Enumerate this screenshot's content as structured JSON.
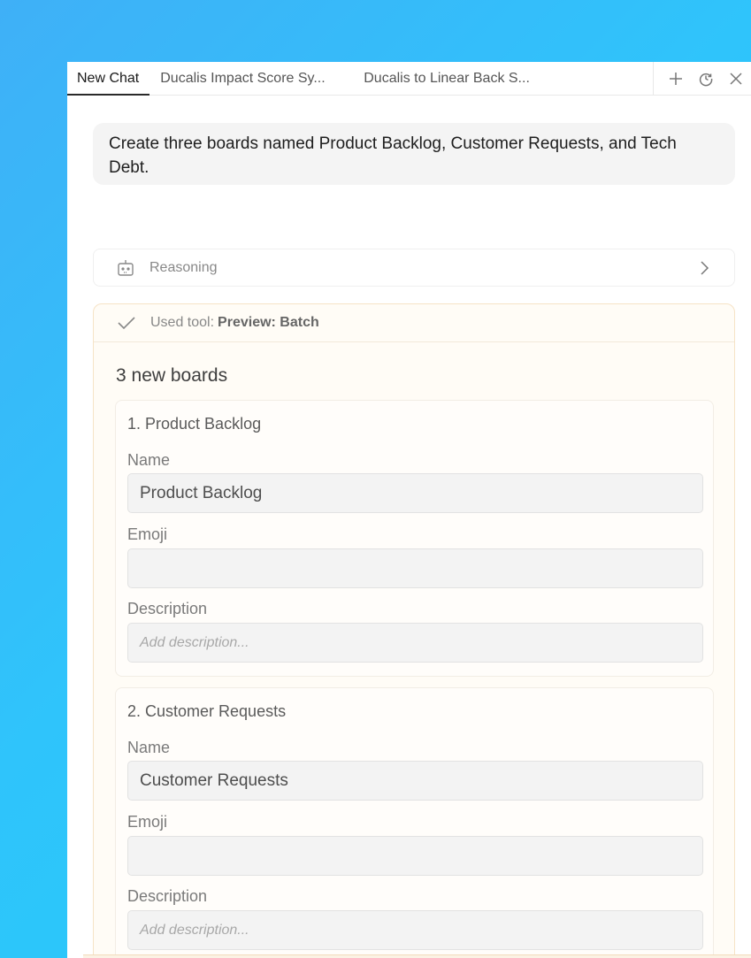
{
  "tabs": [
    {
      "label": "New Chat"
    },
    {
      "label": "Ducalis Impact Score Sy..."
    },
    {
      "label": "Ducalis to Linear Back S..."
    }
  ],
  "tab_actions": {
    "new": "plus-icon",
    "history": "history-icon",
    "close": "close-icon"
  },
  "user_message": "Create three boards named Product Backlog, Customer Requests, and Tech Debt.",
  "reasoning": {
    "label": "Reasoning"
  },
  "tool": {
    "prefix": "Used tool:",
    "name": "Preview: Batch",
    "title": "3 new boards",
    "boards": [
      {
        "heading": "1. Product Backlog",
        "name_label": "Name",
        "name_value": "Product Backlog",
        "emoji_label": "Emoji",
        "emoji_value": "",
        "description_label": "Description",
        "description_placeholder": "Add description..."
      },
      {
        "heading": "2. Customer Requests",
        "name_label": "Name",
        "name_value": "Customer Requests",
        "emoji_label": "Emoji",
        "emoji_value": "",
        "description_label": "Description",
        "description_placeholder": "Add description..."
      }
    ]
  },
  "colors": {
    "background_start": "#3fb0f7",
    "background_end": "#22cdf8",
    "tool_card_bg": "#fffcf6",
    "tool_card_border": "#f6e3c6"
  }
}
